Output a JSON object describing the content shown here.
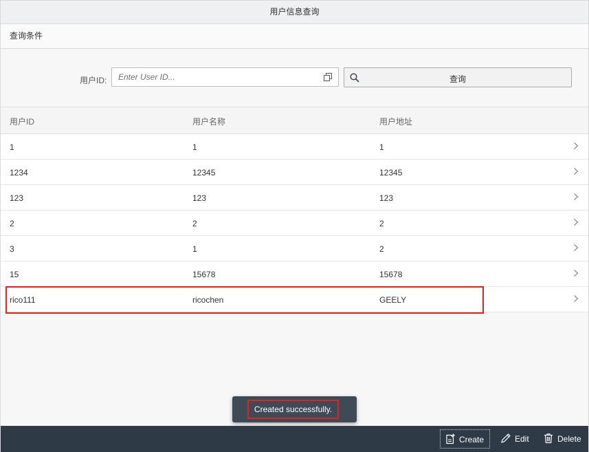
{
  "header": {
    "title": "用户信息查询"
  },
  "section": {
    "title": "查询条件"
  },
  "filter": {
    "label": "用户ID:",
    "placeholder": "Enter User ID...",
    "value": "",
    "query_button": "查询"
  },
  "table": {
    "columns": [
      "用户ID",
      "用户名称",
      "用户地址"
    ],
    "rows": [
      {
        "id": "1",
        "name": "1",
        "address": "1"
      },
      {
        "id": "1234",
        "name": "12345",
        "address": "12345"
      },
      {
        "id": "123",
        "name": "123",
        "address": "123"
      },
      {
        "id": "2",
        "name": "2",
        "address": "2"
      },
      {
        "id": "3",
        "name": "1",
        "address": "2"
      },
      {
        "id": "15",
        "name": "15678",
        "address": "15678"
      },
      {
        "id": "rico111",
        "name": "ricochen",
        "address": "GEELY"
      }
    ]
  },
  "toast": {
    "message": "Created successfully."
  },
  "footer": {
    "create": "Create",
    "edit": "Edit",
    "delete": "Delete"
  },
  "colors": {
    "highlight": "#e0231b",
    "footer_bg": "#2e3a45",
    "toast_bg": "#3e4a56"
  },
  "icons": {
    "value_help": "value-help-icon",
    "search": "search-icon",
    "row_nav": "chevron-right-icon",
    "create": "create-icon",
    "edit": "pencil-icon",
    "delete": "trash-icon"
  }
}
